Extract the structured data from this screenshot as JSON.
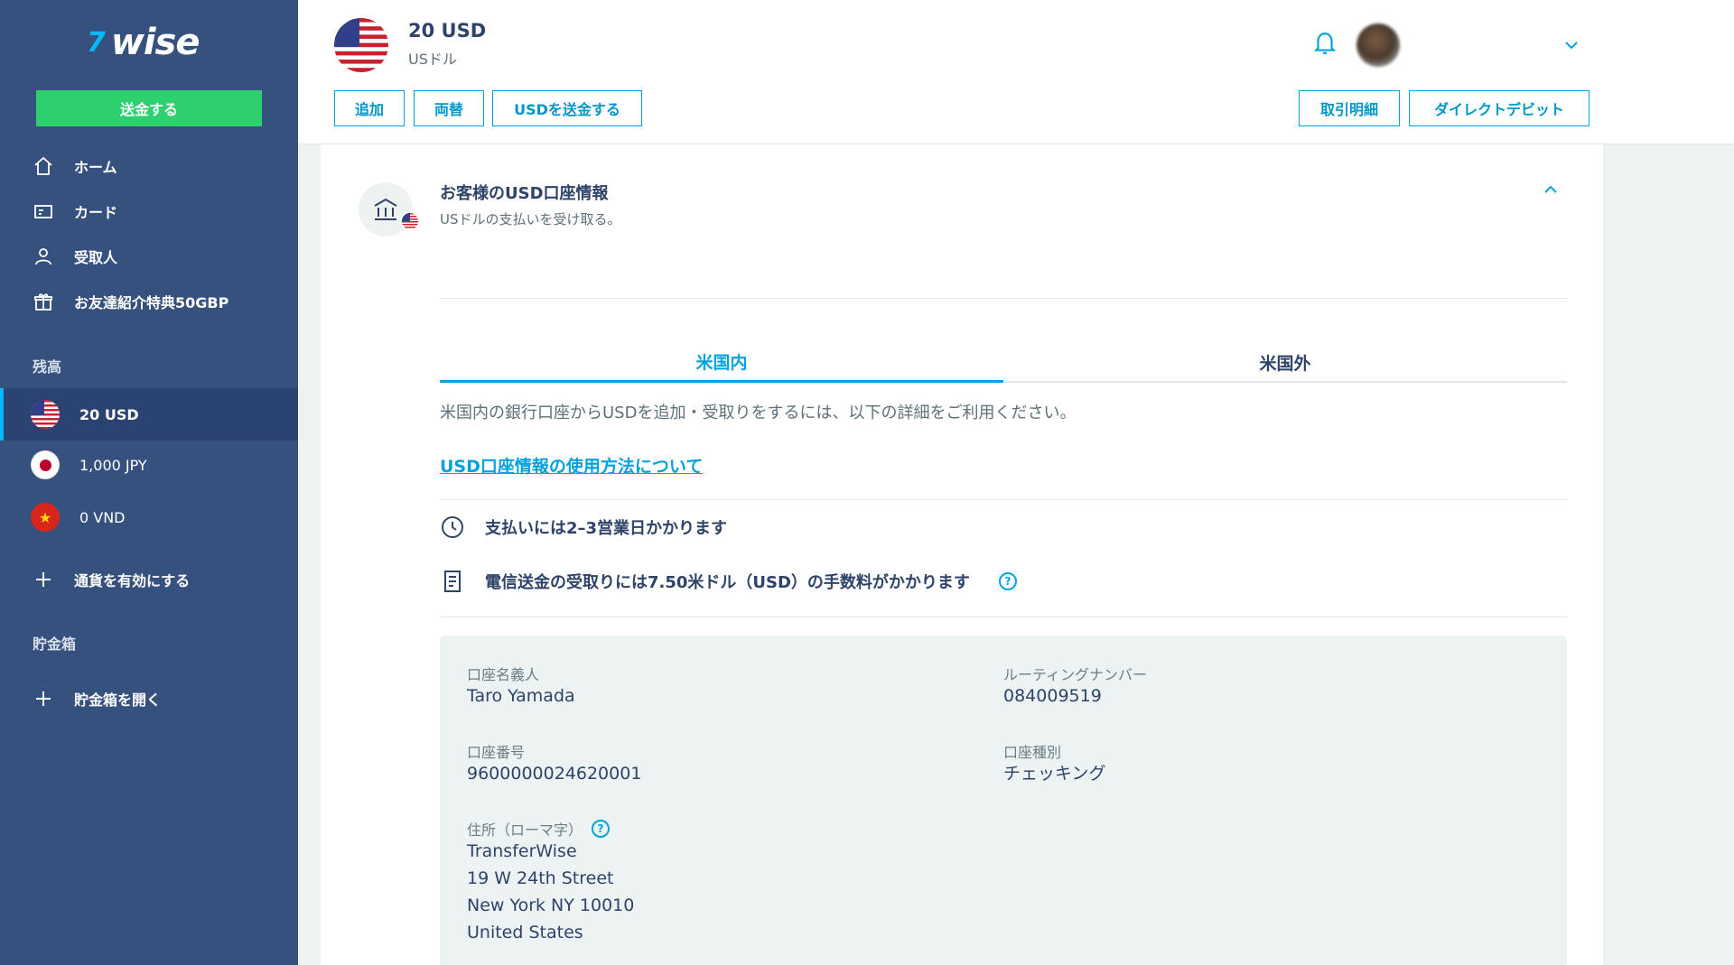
{
  "brand": {
    "mark": "7",
    "name": "wise"
  },
  "sidebar": {
    "send_button": "送金する",
    "nav": [
      {
        "label": "ホーム",
        "icon": "home-icon"
      },
      {
        "label": "カード",
        "icon": "card-icon"
      },
      {
        "label": "受取人",
        "icon": "person-icon"
      },
      {
        "label": "お友達紹介特典50GBP",
        "icon": "gift-icon"
      }
    ],
    "balances_label": "残高",
    "balances": [
      {
        "label": "20 USD",
        "flag": "us-flag"
      },
      {
        "label": "1,000 JPY",
        "flag": "jp-flag"
      },
      {
        "label": "0 VND",
        "flag": "vn-flag"
      }
    ],
    "activate_currency": "通貨を有効にする",
    "jars_label": "貯金箱",
    "open_jar": "貯金箱を開く"
  },
  "header": {
    "title": "20 USD",
    "subtitle": "USドル",
    "buttons": {
      "add": "追加",
      "convert": "両替",
      "send_usd": "USDを送金する",
      "statements": "取引明細",
      "direct_debit": "ダイレクトデビット"
    }
  },
  "account": {
    "title": "お客様のUSD口座情報",
    "subtitle": "USドルの支払いを受け取る。",
    "tabs": [
      "米国内",
      "米国外"
    ],
    "description": "米国内の銀行口座からUSDを追加・受取りをするには、以下の詳細をご利用ください。",
    "link": "USD口座情報の使用方法について",
    "info": [
      {
        "text": "支払いには2–3営業日かかります",
        "icon": "clock-icon"
      },
      {
        "text": "電信送金の受取りには7.50米ドル（USD）の手数料がかかります",
        "icon": "receipt-icon"
      }
    ],
    "details": {
      "holder_label": "口座名義人",
      "holder": "Taro Yamada",
      "routing_label": "ルーティングナンバー",
      "routing": "084009519",
      "account_no_label": "口座番号",
      "account_no": "9600000024620001",
      "type_label": "口座種別",
      "type": "チェッキング",
      "address_label": "住所（ローマ字）",
      "address": [
        "TransferWise",
        "19 W 24th Street",
        "New York NY 10010",
        "United States"
      ]
    }
  },
  "colors": {
    "sidebar": "#37517e",
    "accent": "#00a2dd",
    "send": "#2ed06e"
  }
}
